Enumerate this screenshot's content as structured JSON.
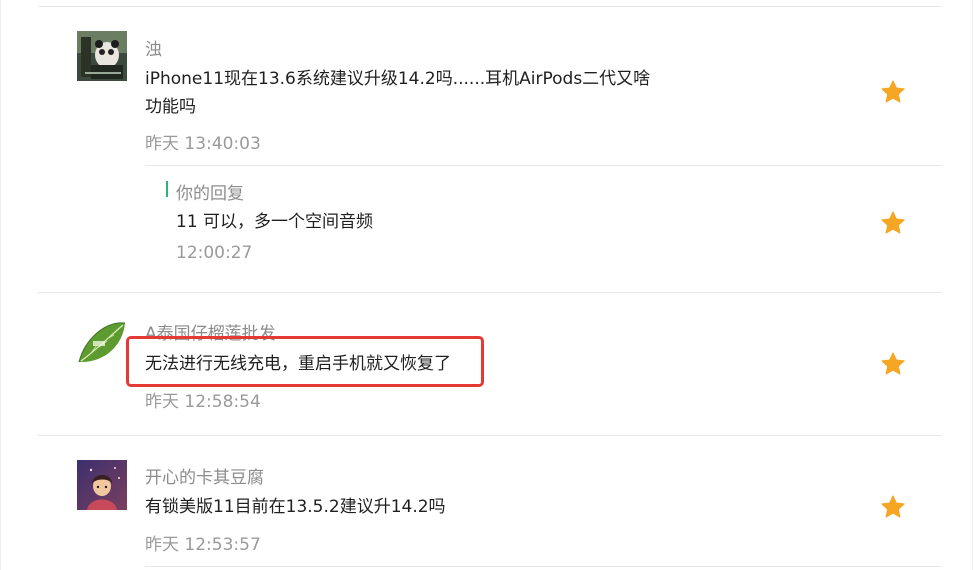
{
  "comments": [
    {
      "author": "浊",
      "content_line1": "iPhone11现在13.6系统建议升级14.2吗......耳机AirPods二代又啥",
      "content_line2": "功能吗",
      "time": "昨天 13:40:03",
      "avatar_icon": "panda-photo-avatar",
      "reply": {
        "label": "你的回复",
        "content": "11 可以，多一个空间音频",
        "time": "12:00:27"
      }
    },
    {
      "author": "A泰国仔榴莲批发",
      "content": "无法进行无线充电，重启手机就又恢复了",
      "time": "昨天 12:58:54",
      "avatar_icon": "leaf-logo-avatar",
      "highlighted": true
    },
    {
      "author": "开心的卡其豆腐",
      "content": "有锁美版11目前在13.5.2建议升14.2吗",
      "time": "昨天 12:53:57",
      "avatar_icon": "illustrated-girl-avatar"
    }
  ],
  "colors": {
    "star": "#f5a623",
    "reply_accent": "#2bb673",
    "highlight": "#e53935",
    "meta_text": "#8c8c8c"
  },
  "icons": {
    "favorite": "star-icon"
  }
}
